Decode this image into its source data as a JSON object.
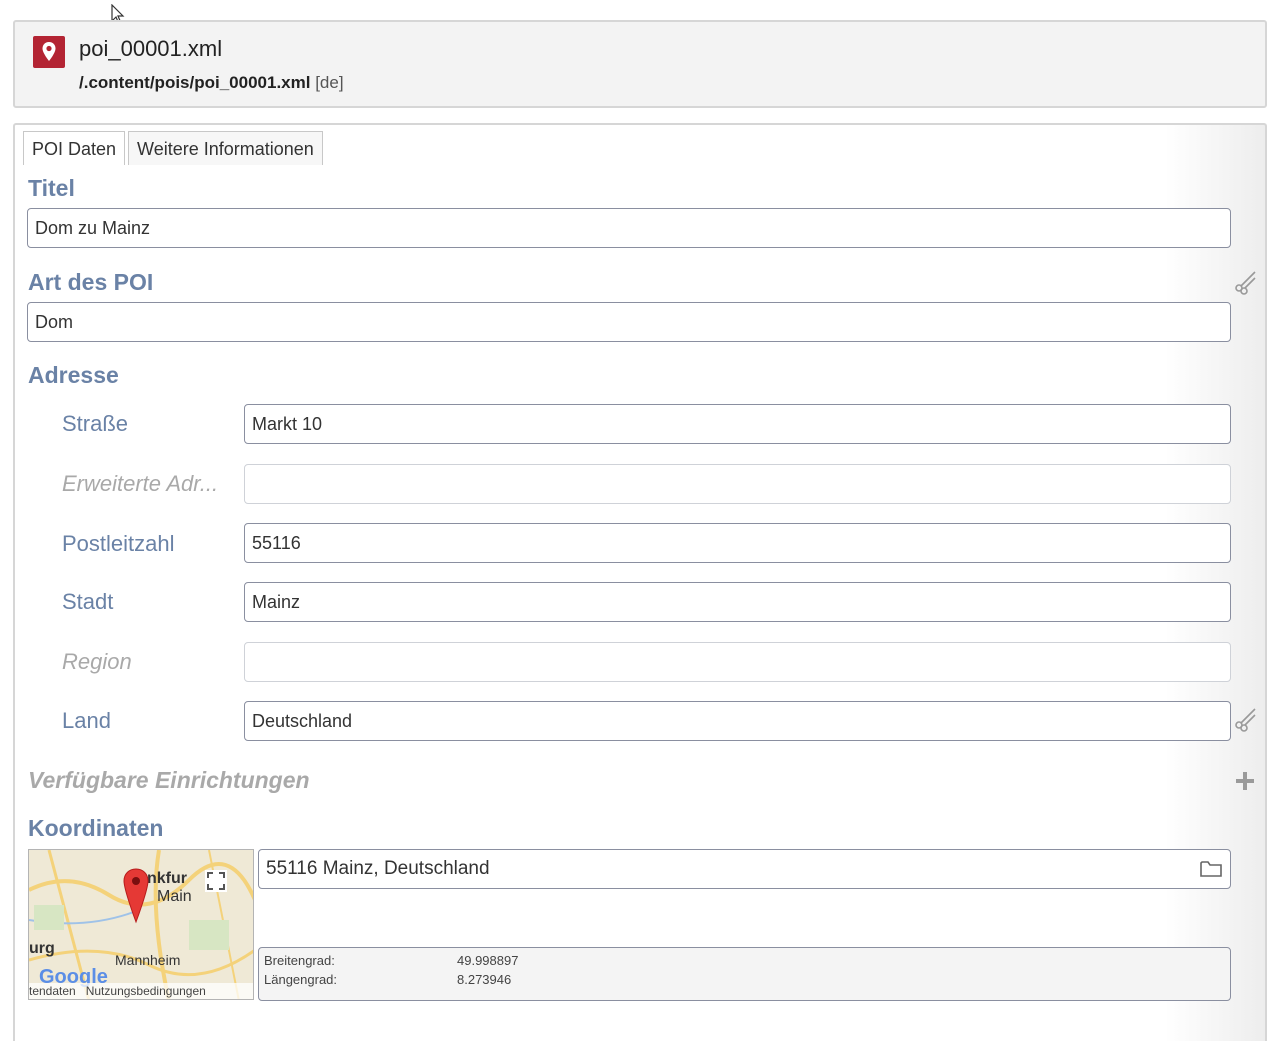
{
  "header": {
    "title": "poi_00001.xml",
    "path": "/.content/pois/poi_00001.xml",
    "locale": "[de]",
    "icon": "map-pin-icon",
    "icon_color": "#b32433"
  },
  "tabs": [
    "POI Daten",
    "Weitere Informationen"
  ],
  "fields": {
    "titel": {
      "label": "Titel",
      "value": "Dom zu Mainz"
    },
    "art": {
      "label": "Art des POI",
      "value": "Dom"
    },
    "adresse": {
      "label": "Adresse",
      "strasse": {
        "label": "Straße",
        "value": "Markt 10"
      },
      "erweitert": {
        "label": "Erweiterte Adr...",
        "value": ""
      },
      "plz": {
        "label": "Postleitzahl",
        "value": "55116"
      },
      "stadt": {
        "label": "Stadt",
        "value": "Mainz"
      },
      "region": {
        "label": "Region",
        "value": ""
      },
      "land": {
        "label": "Land",
        "value": "Deutschland"
      }
    },
    "einrichtungen": {
      "label": "Verfügbare Einrichtungen"
    },
    "koordinaten": {
      "label": "Koordinaten",
      "address": "55116 Mainz, Deutschland",
      "lat_label": "Breitengrad:",
      "lat_value": "49.998897",
      "lng_label": "Längengrad:",
      "lng_value": "8.273946"
    }
  },
  "map": {
    "label_frankfurt": "nkfur",
    "label_main": "Main",
    "label_urg": "urg",
    "label_mannheim": "Mannheim",
    "label_google": "Google",
    "footer_left": "tendaten",
    "footer_terms": "Nutzungsbedingungen"
  },
  "colors": {
    "label_blue": "#6a82a6",
    "brand_red": "#b32433"
  }
}
